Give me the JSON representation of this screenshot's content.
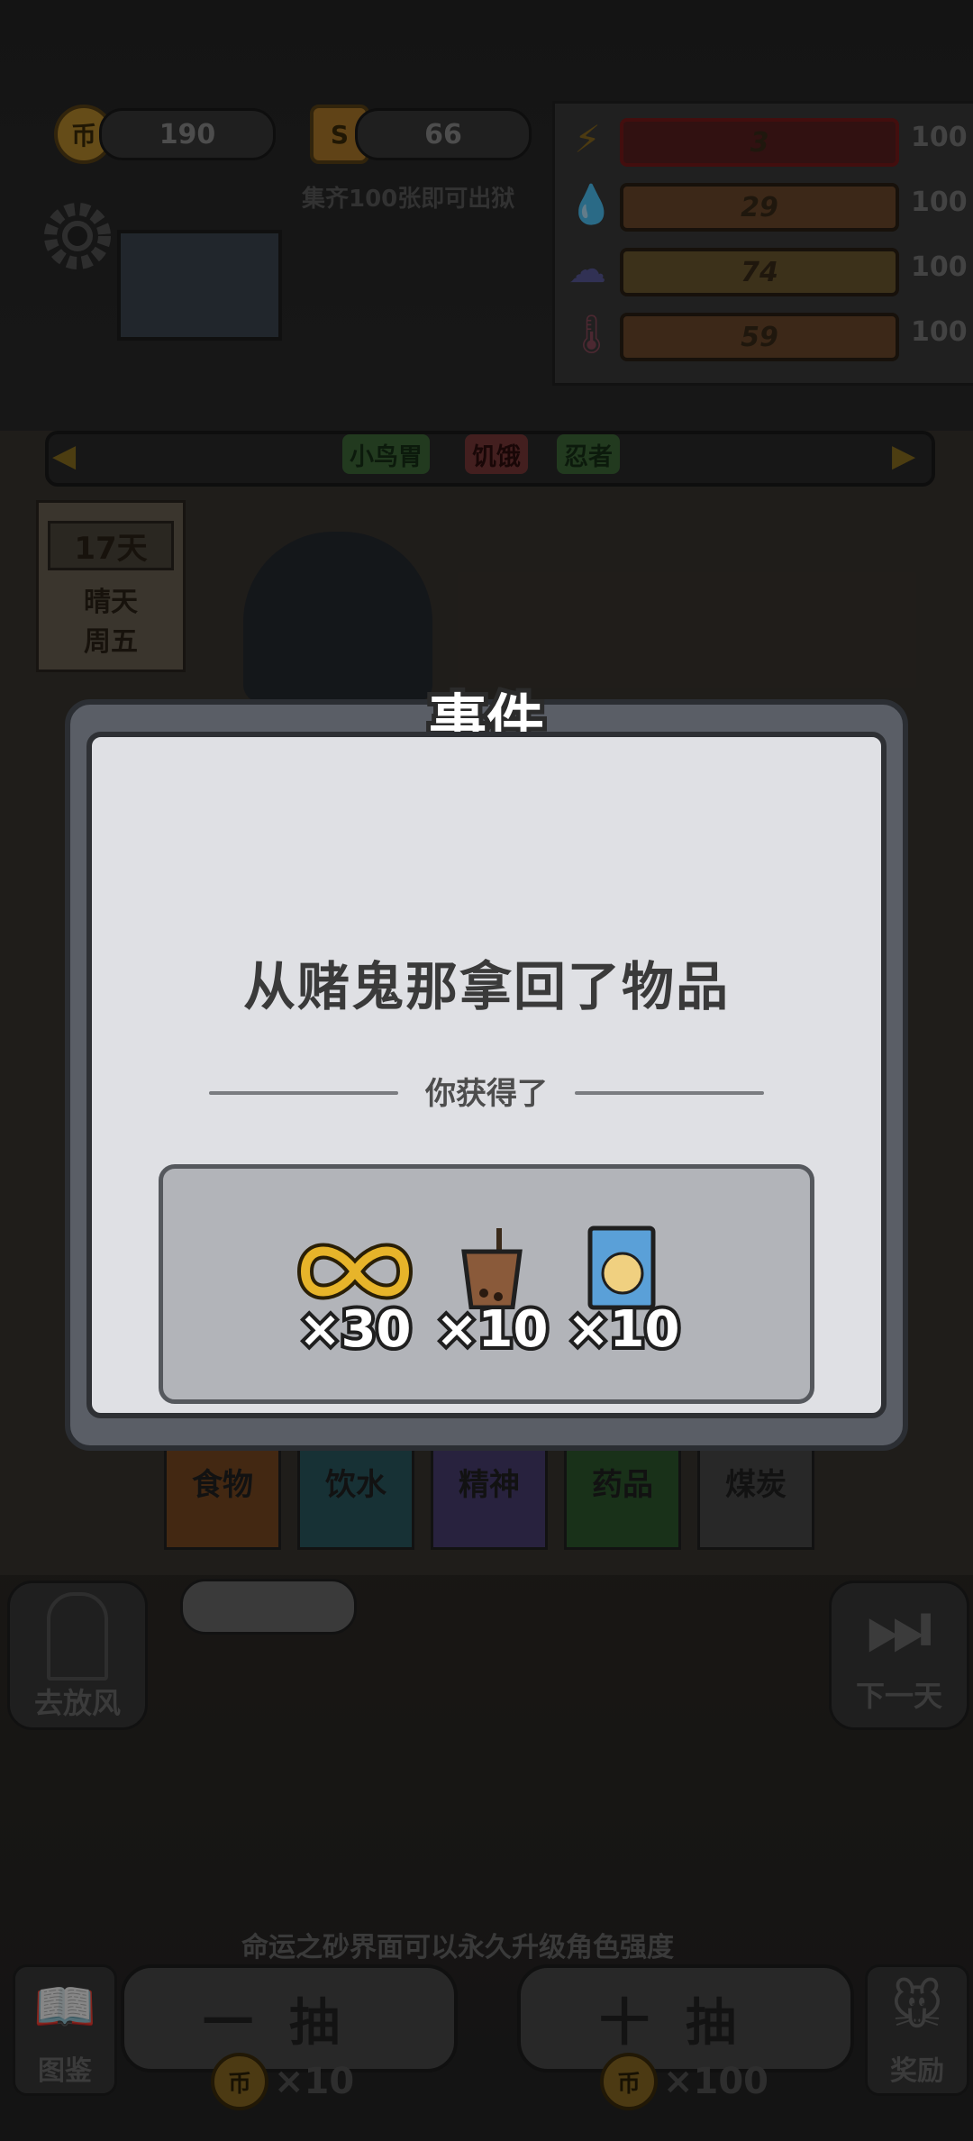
{
  "hud": {
    "coins": "190",
    "tickets": "66",
    "coin_glyph": "币",
    "ticket_glyph": "S",
    "collect_tip": "集齐100张即可出狱"
  },
  "stats": [
    {
      "icon": "lightning-icon",
      "value": "3",
      "max": "100",
      "color": "#c03030"
    },
    {
      "icon": "water-drop-icon",
      "value": "29",
      "max": "100",
      "color": "#b06a3a"
    },
    {
      "icon": "brain-icon",
      "value": "74",
      "max": "100",
      "color": "#b08040"
    },
    {
      "icon": "thermometer-icon",
      "value": "59",
      "max": "100",
      "color": "#b06a3a"
    }
  ],
  "traits": [
    "小鸟胃",
    "饥饿",
    "忍者"
  ],
  "calendar": {
    "day": "17天",
    "weather": "晴天",
    "weekday": "周五"
  },
  "categories": [
    "食物",
    "饮水",
    "精神",
    "药品",
    "煤炭"
  ],
  "side": {
    "left_label": "去放风",
    "right_label": "下一天"
  },
  "bottom": {
    "tip": "命运之砂界面可以永久升级角色强度",
    "album": "图鉴",
    "reward": "奖励",
    "single_draw": "一抽",
    "ten_draw": "十抽",
    "single_cost": "×10",
    "ten_cost": "×100"
  },
  "modal": {
    "title": "事件",
    "message": "从赌鬼那拿回了物品",
    "subtitle": "你获得了",
    "rewards": [
      {
        "icon": "golden-infinity-icon",
        "qty": "×30"
      },
      {
        "icon": "milk-tea-icon",
        "qty": "×10"
      },
      {
        "icon": "manga-book-icon",
        "qty": "×10"
      }
    ]
  }
}
